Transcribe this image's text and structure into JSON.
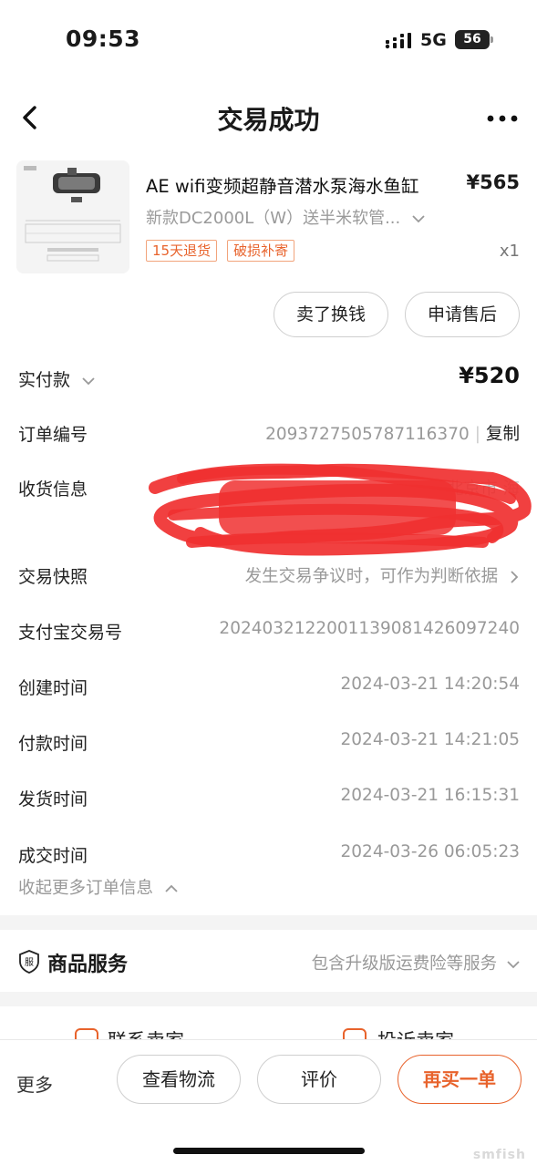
{
  "status_bar": {
    "time": "09:53",
    "network": "5G",
    "battery": "56"
  },
  "nav": {
    "title": "交易成功"
  },
  "product": {
    "title": "AE wifi变频超静音潜水泵海水鱼缸",
    "price": "¥565",
    "spec": "新款DC2000L（W）送半米软管...",
    "tags": [
      "15天退货",
      "破损补寄"
    ],
    "quantity": "x1"
  },
  "actions": {
    "sell_label": "卖了换钱",
    "after_sale_label": "申请售后"
  },
  "order_info": {
    "paid": {
      "label": "实付款",
      "value": "¥520"
    },
    "order_no": {
      "label": "订单编号",
      "value": "2093727505787116370",
      "copy_label": "复制"
    },
    "shipping": {
      "label": "收货信息",
      "value_partial": "北京市 海"
    },
    "snapshot": {
      "label": "交易快照",
      "value": "发生交易争议时，可作为判断依据"
    },
    "alipay_no": {
      "label": "支付宝交易号",
      "value": "2024032122001139081426097240"
    },
    "created": {
      "label": "创建时间",
      "value": "2024-03-21 14:20:54"
    },
    "paid_time": {
      "label": "付款时间",
      "value": "2024-03-21 14:21:05"
    },
    "shipped": {
      "label": "发货时间",
      "value": "2024-03-21 16:15:31"
    },
    "completed": {
      "label": "成交时间",
      "value": "2024-03-26 06:05:23"
    },
    "collapse_label": "收起更多订单信息"
  },
  "service": {
    "icon_text": "服",
    "title": "商品服务",
    "value": "包含升级版运费险等服务"
  },
  "contact": {
    "contact_seller": "联系卖家",
    "complain_seller": "投诉卖家"
  },
  "bottom_bar": {
    "more_label": "更多",
    "logistics_label": "查看物流",
    "review_label": "评价",
    "rebuy_label": "再买一单"
  },
  "watermark": "smfish",
  "colors": {
    "accent": "#e8632c",
    "redaction": "#f03030",
    "muted": "#999999"
  }
}
